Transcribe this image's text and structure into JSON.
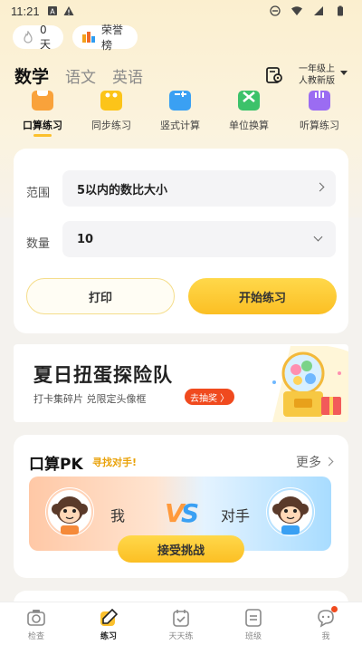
{
  "status_bar": {
    "time": "11:21"
  },
  "top": {
    "streak_label": "0天",
    "honor_label": "荣誉榜"
  },
  "subjects": [
    {
      "label": "数学",
      "active": true
    },
    {
      "label": "语文",
      "active": false
    },
    {
      "label": "英语",
      "active": false
    }
  ],
  "grade": {
    "line1": "一年级上",
    "line2": "人教新版"
  },
  "feature_tabs": [
    {
      "label": "口算练习",
      "active": true
    },
    {
      "label": "同步练习",
      "active": false
    },
    {
      "label": "竖式计算",
      "active": false
    },
    {
      "label": "单位换算",
      "active": false
    },
    {
      "label": "听算练习",
      "active": false
    }
  ],
  "settings": {
    "range_label": "范围",
    "range_value": "5以内的数比大小",
    "count_label": "数量",
    "count_value": "10",
    "print_label": "打印",
    "start_label": "开始练习"
  },
  "banner": {
    "title": "夏日扭蛋探险队",
    "subtitle": "打卡集碎片 兑限定头像框",
    "cta": "去抽奖 〉"
  },
  "pk": {
    "title": "口算PK",
    "subtitle": "寻找对手!",
    "more": "更多",
    "me": "我",
    "opponent": "对手",
    "vs": "VS",
    "accept": "接受挑战"
  },
  "bottom_nav": [
    {
      "label": "检查",
      "icon": "camera-icon",
      "active": false
    },
    {
      "label": "练习",
      "icon": "pencil-icon",
      "active": true
    },
    {
      "label": "天天练",
      "icon": "calendar-check-icon",
      "active": false
    },
    {
      "label": "班级",
      "icon": "class-icon",
      "active": false
    },
    {
      "label": "我",
      "icon": "profile-chat-icon",
      "active": false
    }
  ],
  "colors": {
    "accent": "#fbc02d",
    "cta_red": "#f04a1e",
    "pk_subtitle": "#e9a20a"
  }
}
